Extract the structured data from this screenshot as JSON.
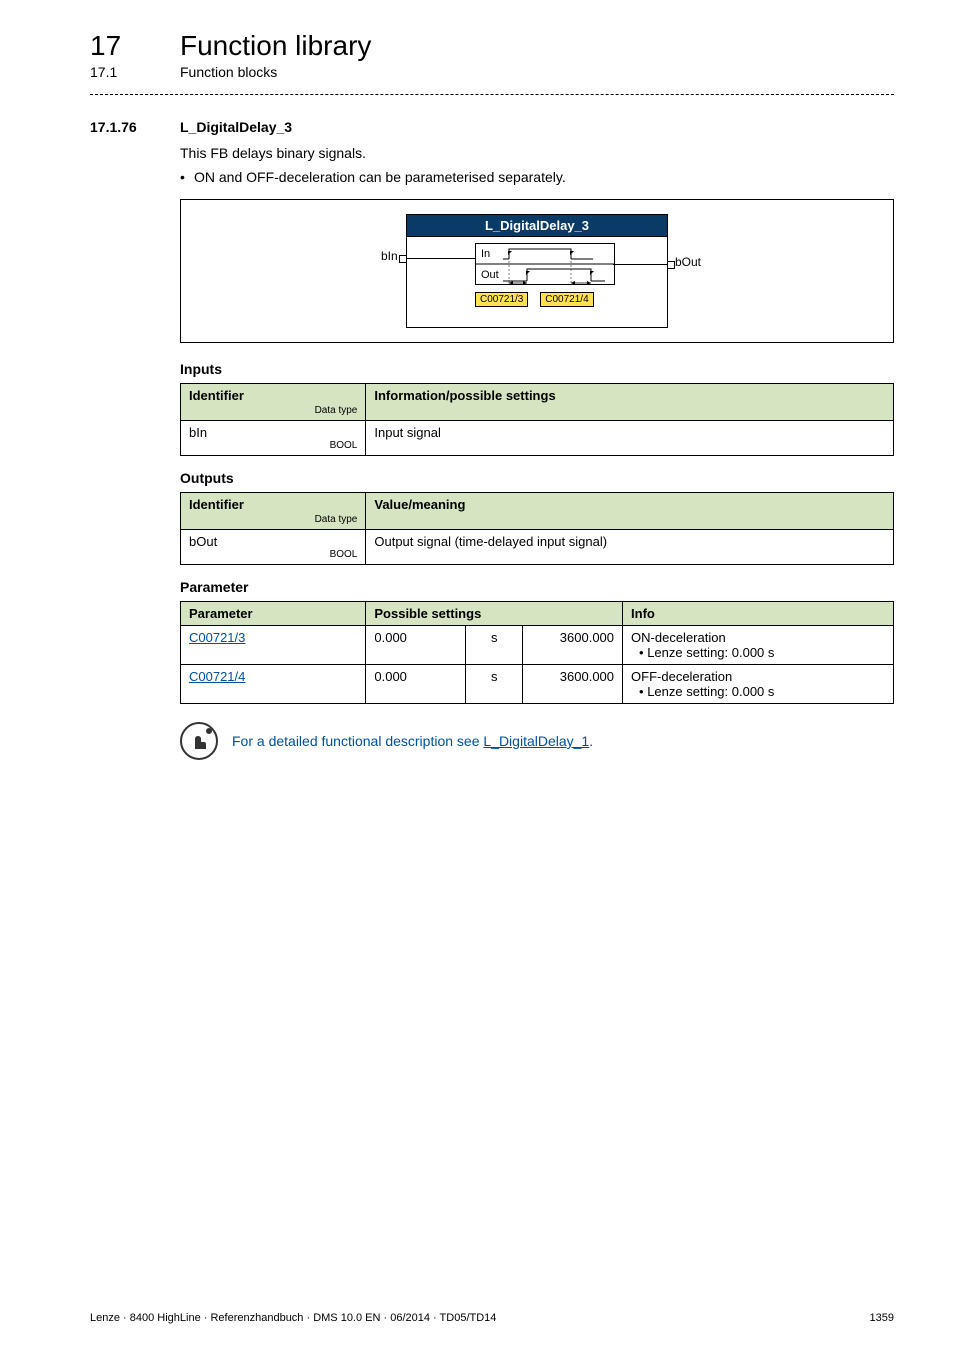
{
  "header": {
    "chapter_num": "17",
    "chapter_title": "Function library",
    "section_num": "17.1",
    "section_title": "Function blocks"
  },
  "subheading": {
    "num": "17.1.76",
    "title": "L_DigitalDelay_3"
  },
  "intro": {
    "line1": "This FB delays binary signals.",
    "bullet1": "ON and OFF-deceleration can be parameterised separately."
  },
  "diagram": {
    "fb_title": "L_DigitalDelay_3",
    "port_in": "bIn",
    "port_out": "bOut",
    "label_in": "In",
    "label_out": "Out",
    "param1": "C00721/3",
    "param2": "C00721/4"
  },
  "sections": {
    "inputs_label": "Inputs",
    "outputs_label": "Outputs",
    "parameter_label": "Parameter"
  },
  "inputs_table": {
    "h_identifier": "Identifier",
    "h_datatype": "Data type",
    "h_info": "Information/possible settings",
    "rows": [
      {
        "id": "bIn",
        "dtype": "BOOL",
        "info": "Input signal"
      }
    ]
  },
  "outputs_table": {
    "h_identifier": "Identifier",
    "h_datatype": "Data type",
    "h_info": "Value/meaning",
    "rows": [
      {
        "id": "bOut",
        "dtype": "BOOL",
        "info": "Output signal (time-delayed input signal)"
      }
    ]
  },
  "params_table": {
    "h_parameter": "Parameter",
    "h_possible": "Possible settings",
    "h_info": "Info",
    "rows": [
      {
        "param": "C00721/3",
        "min": "0.000",
        "unit": "s",
        "max": "3600.000",
        "info_line1": "ON-deceleration",
        "info_line2": "• Lenze setting: 0.000 s"
      },
      {
        "param": "C00721/4",
        "min": "0.000",
        "unit": "s",
        "max": "3600.000",
        "info_line1": "OFF-deceleration",
        "info_line2": "• Lenze setting: 0.000 s"
      }
    ]
  },
  "tip": {
    "prefix": "For a detailed functional description see ",
    "link": "L_DigitalDelay_1",
    "suffix": "."
  },
  "footer": {
    "left": "Lenze · 8400 HighLine · Referenzhandbuch · DMS 10.0 EN · 06/2014 · TD05/TD14",
    "right": "1359"
  }
}
